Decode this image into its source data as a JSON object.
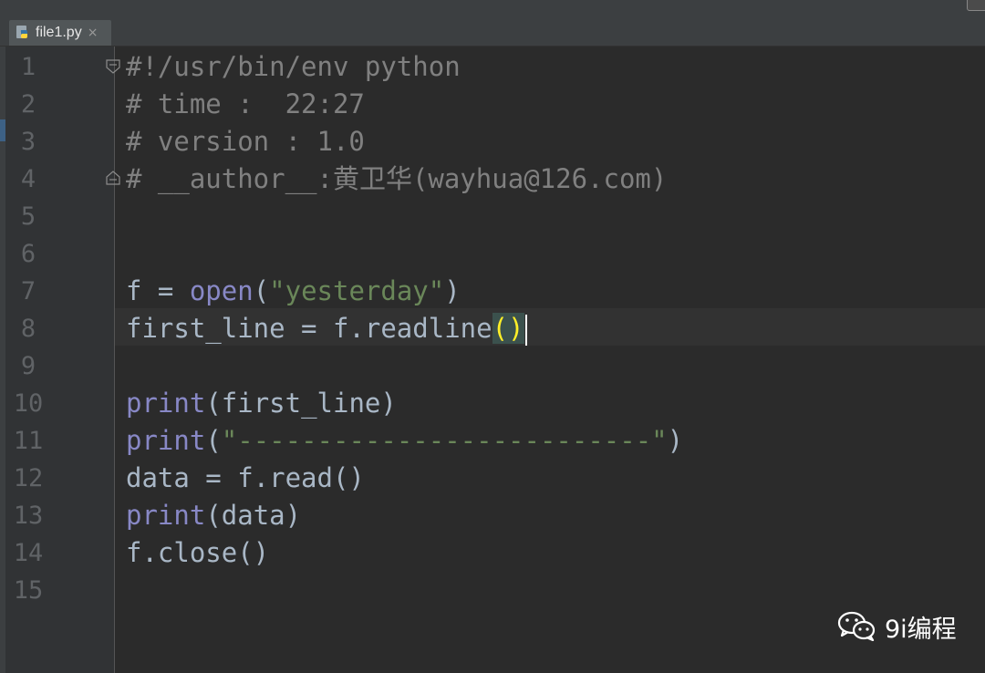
{
  "tab": {
    "filename": "file1.py",
    "close": "×"
  },
  "gutter": {
    "line_numbers": [
      "1",
      "2",
      "3",
      "4",
      "5",
      "6",
      "7",
      "8",
      "9",
      "10",
      "11",
      "12",
      "13",
      "14",
      "15"
    ]
  },
  "code": {
    "line1": "#!/usr/bin/env python",
    "line2": "# time :  22:27",
    "line3": "# version : 1.0",
    "line4": "# __author__:黄卫华(wayhua@126.com)",
    "line7": {
      "var": "f = ",
      "fn": "open",
      "open_paren": "(",
      "arg": "\"yesterday\"",
      "close_paren": ")"
    },
    "line8": {
      "text": "first_line = f.readline",
      "parens": "()"
    },
    "line10": {
      "fn": "print",
      "rest": "(first_line)"
    },
    "line11": {
      "fn": "print",
      "open_paren": "(",
      "arg": "\"--------------------------\"",
      "close_paren": ")"
    },
    "line12": "data = f.read()",
    "line13": {
      "fn": "print",
      "rest": "(data)"
    },
    "line14": "f.close()"
  },
  "current_line": 8,
  "watermark": {
    "icon": "wechat-icon",
    "text": "9i编程"
  },
  "colors": {
    "background": "#2b2b2b",
    "comment": "#808080",
    "builtin": "#8888c6",
    "string": "#6a8759",
    "brace_match": "#ffef28"
  }
}
